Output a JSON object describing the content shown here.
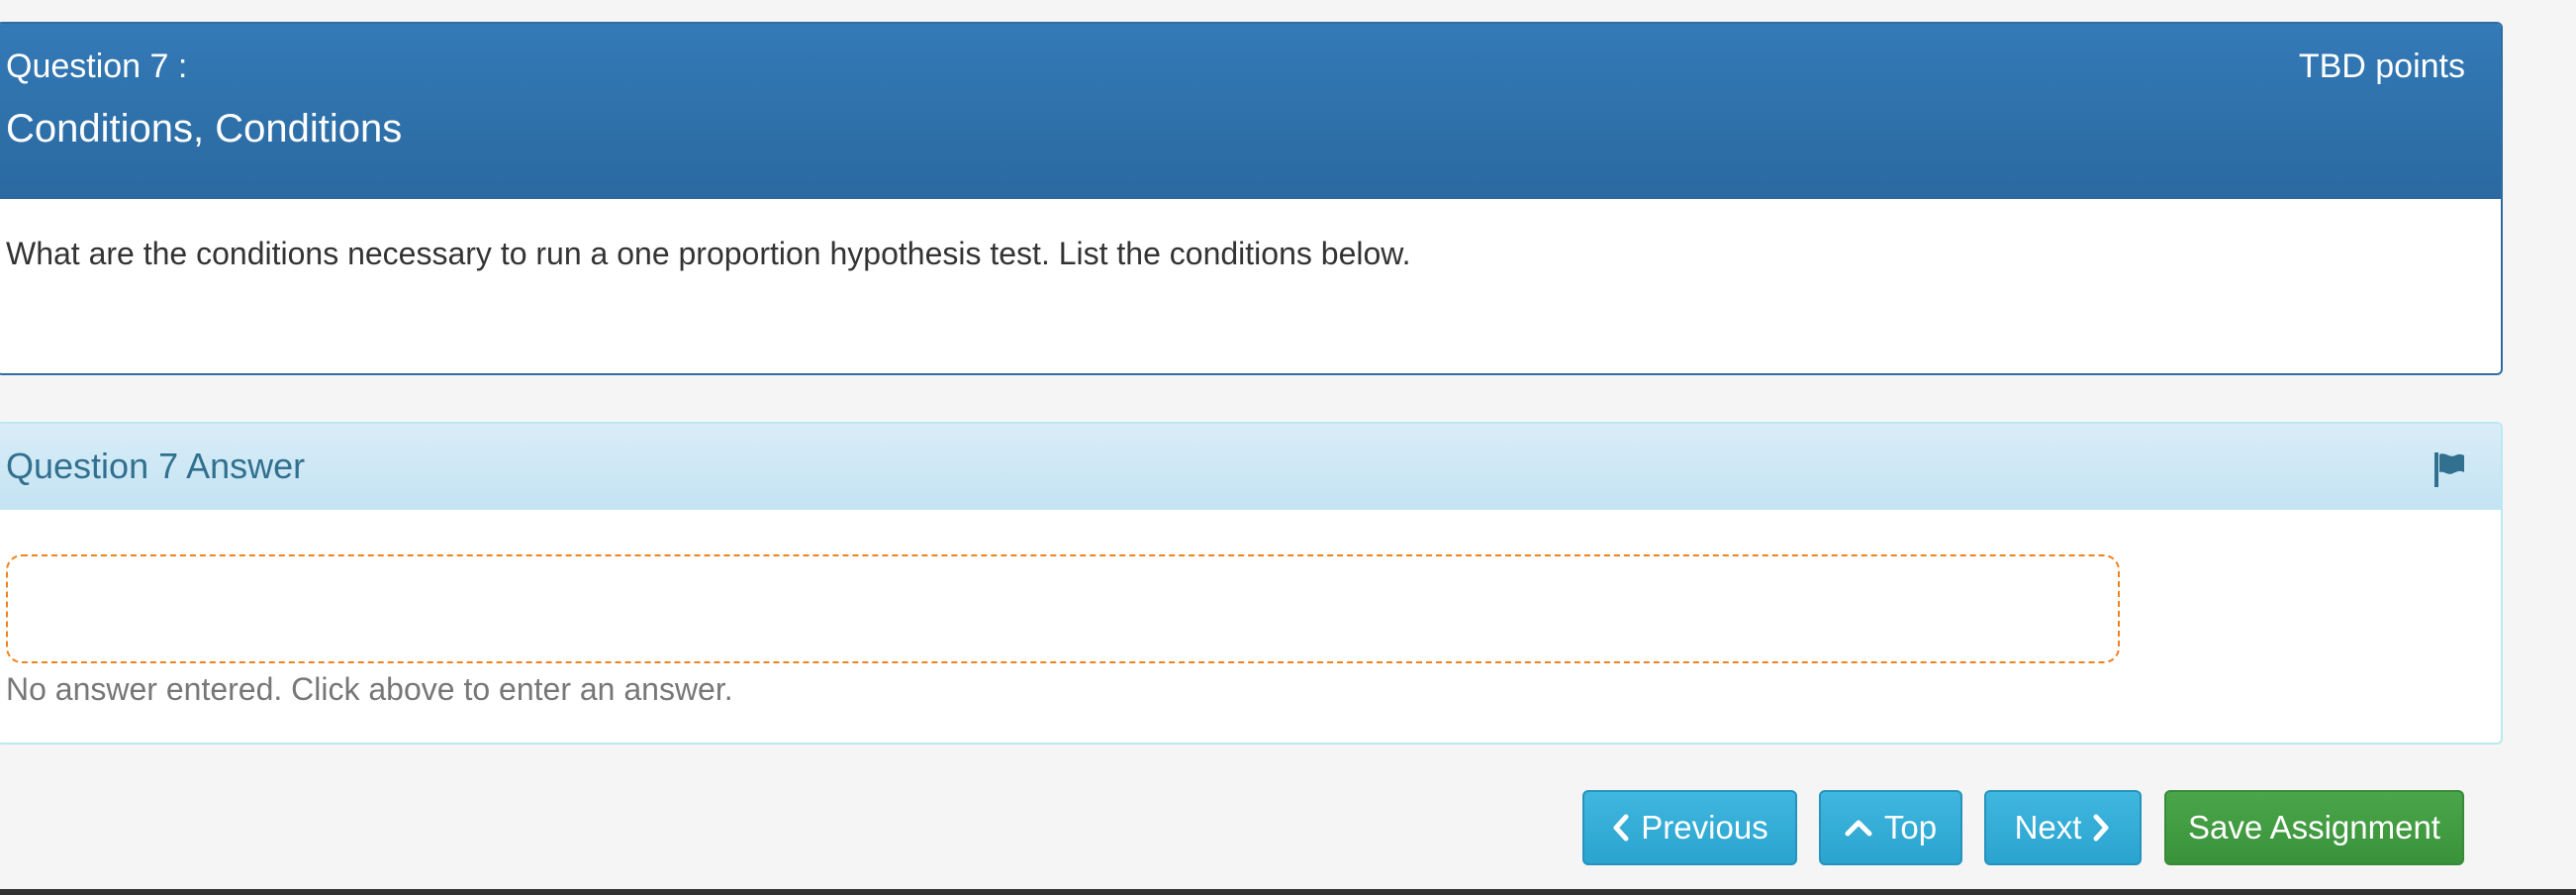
{
  "question": {
    "number_label": "Question 7 :",
    "title": "Conditions, Conditions",
    "points": "TBD points",
    "body": "What are the conditions necessary to run a one proportion hypothesis test. List the conditions below."
  },
  "answer": {
    "heading": "Question 7 Answer",
    "flag_icon": "flag-icon",
    "status_text": "No answer entered. Click above to enter an answer."
  },
  "nav": {
    "previous_label": "Previous",
    "previous_icon": "chevron-left-icon",
    "top_label": "Top",
    "top_icon": "chevron-up-icon",
    "next_label": "Next",
    "next_icon": "chevron-right-icon",
    "save_label": "Save Assignment"
  },
  "colors": {
    "question_header": "#337ab7",
    "answer_header": "#d9edf7",
    "answer_header_text": "#31708f",
    "answer_box_border": "#f0831e",
    "info_button": "#31b0d5",
    "success_button": "#449d44"
  }
}
